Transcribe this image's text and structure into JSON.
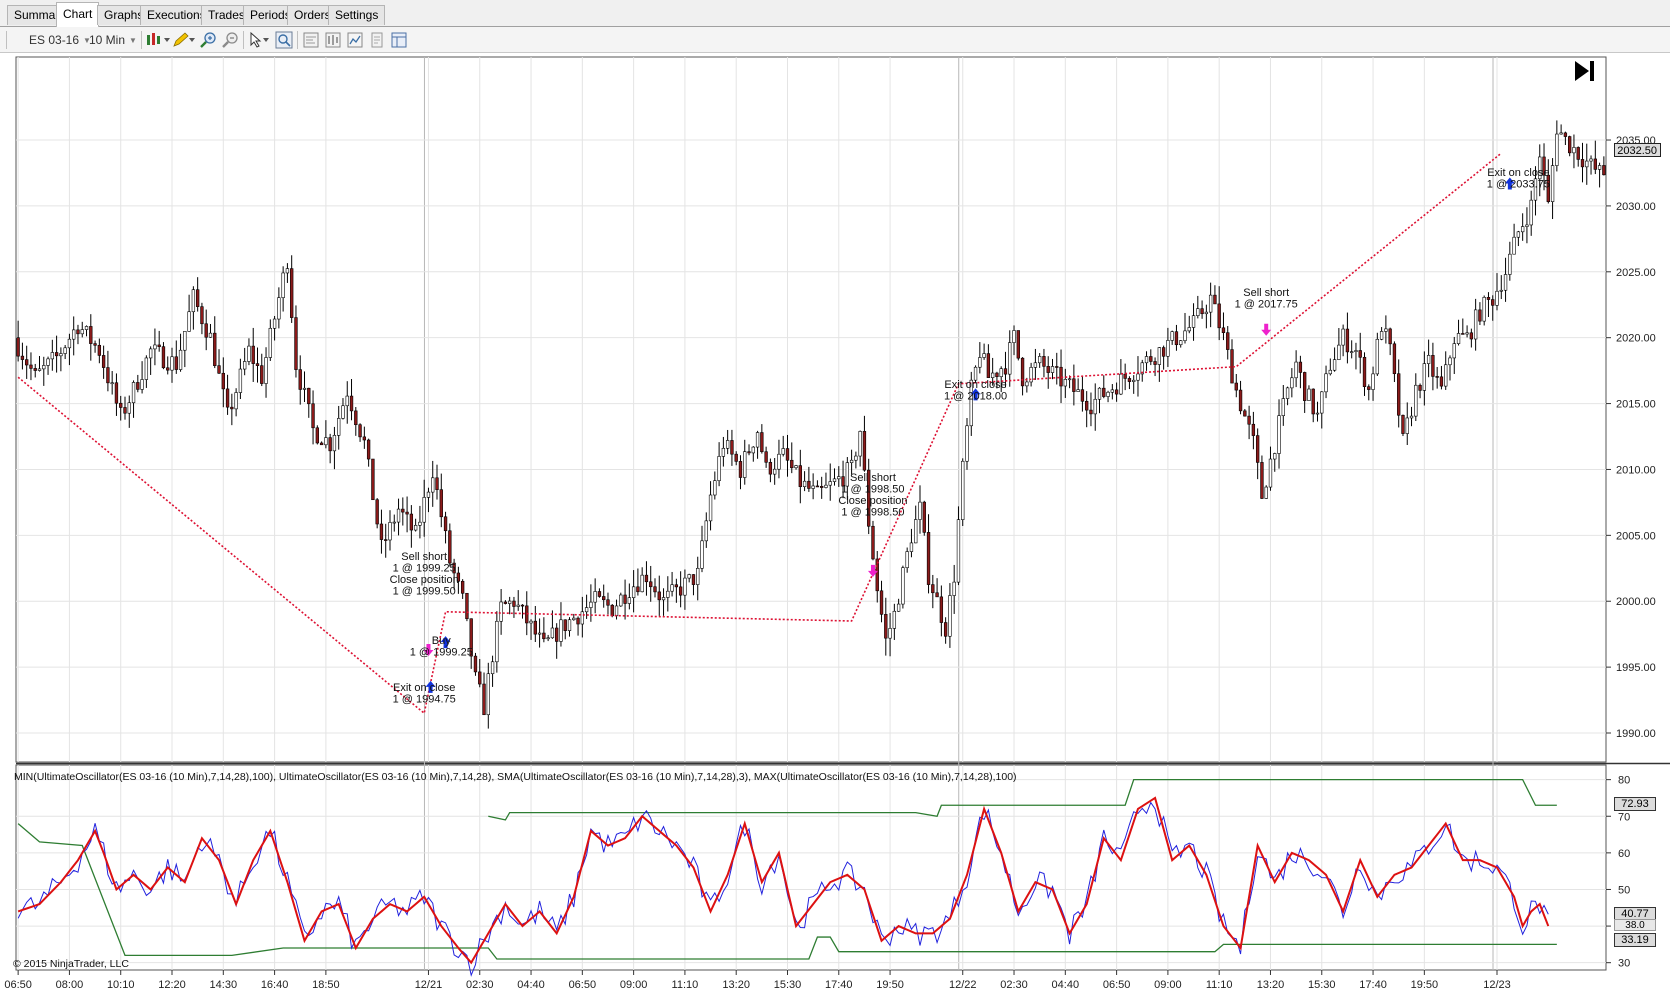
{
  "tabs": [
    {
      "label": "Summary",
      "active": false
    },
    {
      "label": "Chart",
      "active": true
    },
    {
      "label": "Graphs",
      "active": false
    },
    {
      "label": "Executions",
      "active": false
    },
    {
      "label": "Trades",
      "active": false
    },
    {
      "label": "Periods",
      "active": false
    },
    {
      "label": "Orders",
      "active": false
    },
    {
      "label": "Settings",
      "active": false
    }
  ],
  "toolbar": {
    "instrument": "ES 03-16",
    "interval": "10 Min",
    "icons": [
      "bar-type-icon",
      "pencil-icon",
      "zoom-in-icon",
      "zoom-out-icon",
      "pointer-icon",
      "find-icon",
      "properties-icon",
      "data-box-icon",
      "chart-style-icon",
      "copy-icon",
      "panels-icon"
    ]
  },
  "price_panel": {
    "current_price_label": "2032.50",
    "y_ticks": [
      "2035.00",
      "2030.00",
      "2025.00",
      "2020.00",
      "2015.00",
      "2010.00",
      "2005.00",
      "2000.00",
      "1995.00",
      "1990.00"
    ],
    "y_tick_values": [
      2035,
      2030,
      2025,
      2020,
      2015,
      2010,
      2005,
      2000,
      1995,
      1990
    ],
    "ylim": [
      1987.8,
      2041.3
    ],
    "trade_labels": [
      {
        "lines": [
          "Sell short",
          "1 @ 1999.25",
          "Close position",
          "1 @ 1999.50"
        ],
        "anchor": "first-sell"
      },
      {
        "lines": [
          "Buy",
          "1 @ 1999.25"
        ],
        "anchor": "buy"
      },
      {
        "lines": [
          "Exit on close",
          "1 @ 1994.75"
        ],
        "anchor": "exit-1"
      },
      {
        "lines": [
          "Sell short",
          "1 @ 1998.50",
          "Close position",
          "1 @ 1998.50"
        ],
        "anchor": "second-sell"
      },
      {
        "lines": [
          "Exit on close",
          "1 @ 2018.00"
        ],
        "anchor": "exit-2"
      },
      {
        "lines": [
          "Sell short",
          "1 @ 2017.75"
        ],
        "anchor": "third-sell"
      },
      {
        "lines": [
          "Exit on close",
          "1 @ 2033.75"
        ],
        "anchor": "exit-3"
      }
    ]
  },
  "indicator_panel": {
    "title": "MIN(UltimateOscillator(ES 03-16 (10 Min),7,14,28),100), UltimateOscillator(ES 03-16 (10 Min),7,14,28), SMA(UltimateOscillator(ES 03-16 (10 Min),7,14,28),3), MAX(UltimateOscillator(ES 03-16 (10 Min),7,14,28),100)",
    "y_ticks": [
      "80",
      "70",
      "60",
      "50",
      "40",
      "30"
    ],
    "y_tick_values": [
      80,
      70,
      60,
      50,
      40,
      30
    ],
    "ylim": [
      28,
      84
    ],
    "badges": [
      "72.93",
      "40.77",
      "38.0",
      "33.19"
    ]
  },
  "x_axis": {
    "labels": [
      "06:50",
      "08:00",
      "10:10",
      "12:20",
      "14:30",
      "16:40",
      "18:50",
      "12/21",
      "02:30",
      "04:40",
      "06:50",
      "09:00",
      "11:10",
      "13:20",
      "15:30",
      "17:40",
      "19:50",
      "12/22",
      "02:30",
      "04:40",
      "06:50",
      "09:00",
      "11:10",
      "13:20",
      "15:30",
      "17:40",
      "19:50",
      "12/23"
    ]
  },
  "copyright": "© 2015 NinjaTrader, LLC",
  "colors": {
    "up": "#ffffff",
    "down": "#8b1a1a",
    "wick": "#000000",
    "uo": "#2222dd",
    "sma": "#dd1111",
    "minmax": "#2e7d32",
    "trade_line": "#dd1133",
    "marker_sell": "#ee22cc",
    "marker_buy": "#1133dd",
    "grid": "#e4e4e4"
  },
  "chart_data": {
    "type": "candlestick",
    "series_names": [
      "MIN(UltimateOscillator(ES 03-16 (10 Min),7,14,28),100)",
      "UltimateOscillator(ES 03-16 (10 Min),7,14,28)",
      "SMA(UltimateOscillator(ES 03-16 (10 Min),7,14,28),3)",
      "MAX(UltimateOscillator(ES 03-16 (10 Min),7,14,28),100)"
    ],
    "price_path": [
      [
        0,
        2020
      ],
      [
        5,
        2017
      ],
      [
        10,
        2018.5
      ],
      [
        15,
        2021
      ],
      [
        20,
        2019
      ],
      [
        25,
        2014
      ],
      [
        28,
        2016
      ],
      [
        32,
        2019
      ],
      [
        38,
        2018
      ],
      [
        42,
        2023
      ],
      [
        46,
        2020
      ],
      [
        50,
        2014
      ],
      [
        55,
        2019
      ],
      [
        58,
        2017
      ],
      [
        62,
        2023
      ],
      [
        64,
        2026
      ],
      [
        66,
        2018
      ],
      [
        70,
        2013
      ],
      [
        74,
        2012
      ],
      [
        78,
        2016
      ],
      [
        82,
        2012
      ],
      [
        86,
        2004
      ],
      [
        90,
        2007
      ],
      [
        94,
        2005
      ],
      [
        98,
        2010
      ],
      [
        102,
        2003
      ],
      [
        105,
        2000
      ],
      [
        108,
        1994
      ],
      [
        110,
        1992
      ],
      [
        112,
        1996
      ],
      [
        114,
        1999.5
      ],
      [
        117,
        2000
      ],
      [
        120,
        1998.5
      ],
      [
        124,
        1996.5
      ],
      [
        128,
        1998
      ],
      [
        132,
        1999
      ],
      [
        136,
        2000
      ],
      [
        140,
        1999.5
      ],
      [
        144,
        2001
      ],
      [
        148,
        2002
      ],
      [
        152,
        2000
      ],
      [
        156,
        2001
      ],
      [
        160,
        2002
      ],
      [
        163,
        2008
      ],
      [
        166,
        2012
      ],
      [
        170,
        2010
      ],
      [
        174,
        2013
      ],
      [
        176,
        2010
      ],
      [
        180,
        2011
      ],
      [
        184,
        2009
      ],
      [
        188,
        2008
      ],
      [
        192,
        2009
      ],
      [
        196,
        2010
      ],
      [
        198,
        2013
      ],
      [
        200,
        2006
      ],
      [
        202,
        2001
      ],
      [
        204,
        1997
      ],
      [
        206,
        1999
      ],
      [
        208,
        2002
      ],
      [
        210,
        2005
      ],
      [
        212,
        2007
      ],
      [
        214,
        2002
      ],
      [
        216,
        2000
      ],
      [
        218,
        1998
      ],
      [
        220,
        2002
      ],
      [
        222,
        2010
      ],
      [
        224,
        2016
      ],
      [
        226,
        2019
      ],
      [
        228,
        2017
      ],
      [
        232,
        2018
      ],
      [
        234,
        2020
      ],
      [
        236,
        2017
      ],
      [
        240,
        2018
      ],
      [
        244,
        2017
      ],
      [
        248,
        2016
      ],
      [
        252,
        2015
      ],
      [
        256,
        2016
      ],
      [
        260,
        2017
      ],
      [
        264,
        2018
      ],
      [
        268,
        2019
      ],
      [
        272,
        2020
      ],
      [
        276,
        2021
      ],
      [
        280,
        2023
      ],
      [
        283,
        2020
      ],
      [
        286,
        2016
      ],
      [
        290,
        2012
      ],
      [
        292,
        2008
      ],
      [
        295,
        2012
      ],
      [
        298,
        2016
      ],
      [
        300,
        2018
      ],
      [
        302,
        2016
      ],
      [
        305,
        2014
      ],
      [
        308,
        2018
      ],
      [
        311,
        2020
      ],
      [
        314,
        2019
      ],
      [
        317,
        2016
      ],
      [
        320,
        2021
      ],
      [
        322,
        2019
      ],
      [
        325,
        2012
      ],
      [
        328,
        2016
      ],
      [
        331,
        2018
      ],
      [
        334,
        2016
      ],
      [
        337,
        2020
      ],
      [
        340,
        2020
      ],
      [
        343,
        2022
      ],
      [
        346,
        2023
      ],
      [
        349,
        2025
      ],
      [
        352,
        2028
      ],
      [
        355,
        2030
      ],
      [
        357,
        2034
      ],
      [
        359,
        2030
      ],
      [
        361,
        2036
      ],
      [
        363,
        2035
      ],
      [
        366,
        2034
      ],
      [
        369,
        2033
      ],
      [
        371,
        2032.5
      ]
    ],
    "uo_path": [
      [
        0,
        44
      ],
      [
        5,
        46
      ],
      [
        10,
        52
      ],
      [
        14,
        58
      ],
      [
        18,
        66
      ],
      [
        20,
        60
      ],
      [
        23,
        50
      ],
      [
        27,
        54
      ],
      [
        31,
        50
      ],
      [
        35,
        56
      ],
      [
        39,
        52
      ],
      [
        43,
        64
      ],
      [
        47,
        58
      ],
      [
        51,
        46
      ],
      [
        55,
        58
      ],
      [
        59,
        66
      ],
      [
        63,
        52
      ],
      [
        67,
        36
      ],
      [
        71,
        44
      ],
      [
        75,
        46
      ],
      [
        79,
        34
      ],
      [
        83,
        42
      ],
      [
        87,
        46
      ],
      [
        91,
        44
      ],
      [
        95,
        48
      ],
      [
        99,
        40
      ],
      [
        103,
        34
      ],
      [
        106,
        30
      ],
      [
        110,
        38
      ],
      [
        114,
        46
      ],
      [
        118,
        40
      ],
      [
        122,
        44
      ],
      [
        126,
        38
      ],
      [
        130,
        48
      ],
      [
        134,
        66
      ],
      [
        138,
        62
      ],
      [
        142,
        64
      ],
      [
        146,
        70
      ],
      [
        150,
        66
      ],
      [
        154,
        62
      ],
      [
        158,
        56
      ],
      [
        162,
        44
      ],
      [
        166,
        54
      ],
      [
        170,
        68
      ],
      [
        174,
        52
      ],
      [
        178,
        60
      ],
      [
        182,
        40
      ],
      [
        186,
        46
      ],
      [
        190,
        52
      ],
      [
        194,
        54
      ],
      [
        198,
        50
      ],
      [
        202,
        36
      ],
      [
        206,
        40
      ],
      [
        210,
        38
      ],
      [
        214,
        38
      ],
      [
        218,
        42
      ],
      [
        222,
        54
      ],
      [
        226,
        72
      ],
      [
        230,
        60
      ],
      [
        234,
        44
      ],
      [
        238,
        52
      ],
      [
        242,
        50
      ],
      [
        246,
        38
      ],
      [
        250,
        46
      ],
      [
        254,
        64
      ],
      [
        258,
        58
      ],
      [
        262,
        72
      ],
      [
        266,
        75
      ],
      [
        270,
        58
      ],
      [
        274,
        62
      ],
      [
        278,
        54
      ],
      [
        282,
        40
      ],
      [
        286,
        34
      ],
      [
        290,
        62
      ],
      [
        294,
        52
      ],
      [
        298,
        60
      ],
      [
        302,
        58
      ],
      [
        306,
        54
      ],
      [
        310,
        44
      ],
      [
        314,
        58
      ],
      [
        318,
        48
      ],
      [
        322,
        54
      ],
      [
        326,
        56
      ],
      [
        330,
        62
      ],
      [
        334,
        68
      ],
      [
        338,
        58
      ],
      [
        342,
        58
      ],
      [
        346,
        56
      ],
      [
        350,
        48
      ],
      [
        352,
        40
      ],
      [
        354,
        44
      ],
      [
        356,
        46
      ],
      [
        358,
        40
      ]
    ],
    "min_path": [
      [
        0,
        68
      ],
      [
        5,
        63
      ],
      [
        15,
        62
      ],
      [
        25,
        32
      ],
      [
        50,
        32
      ],
      [
        62,
        34
      ],
      [
        110,
        34
      ],
      [
        112,
        31
      ],
      [
        185,
        31
      ],
      [
        187,
        37
      ],
      [
        190,
        37
      ],
      [
        192,
        33
      ],
      [
        280,
        33
      ],
      [
        282,
        35
      ],
      [
        360,
        35
      ]
    ],
    "max_path": [
      [
        110,
        70
      ],
      [
        114,
        69
      ],
      [
        115,
        71
      ],
      [
        210,
        71
      ],
      [
        215,
        70
      ],
      [
        216,
        73
      ],
      [
        259,
        73
      ],
      [
        261,
        80
      ],
      [
        352,
        80
      ],
      [
        355,
        73
      ],
      [
        360,
        73
      ]
    ],
    "trade_line": [
      [
        0,
        2017
      ],
      [
        95,
        1991.5
      ],
      [
        100,
        1999.2
      ],
      [
        195,
        1998.5
      ],
      [
        220,
        2016.5
      ],
      [
        285,
        2017.8
      ],
      [
        347,
        2034
      ]
    ],
    "markers": [
      {
        "type": "sell",
        "i": 96,
        "p": 1996
      },
      {
        "type": "buy",
        "i": 96.5,
        "p": 1993.8
      },
      {
        "type": "buy",
        "i": 100,
        "p": 1997.2
      },
      {
        "type": "sell",
        "i": 200,
        "p": 2002
      },
      {
        "type": "buy",
        "i": 224,
        "p": 2016
      },
      {
        "type": "sell",
        "i": 292,
        "p": 2020.3
      },
      {
        "type": "buy",
        "i": 349,
        "p": 2032
      }
    ],
    "x_label_positions": [
      0,
      12,
      24,
      36,
      48,
      60,
      72,
      96,
      108,
      120,
      132,
      144,
      156,
      168,
      180,
      192,
      204,
      221,
      233,
      245,
      257,
      269,
      281,
      293,
      305,
      317,
      329,
      346
    ],
    "n_bars": 372
  }
}
